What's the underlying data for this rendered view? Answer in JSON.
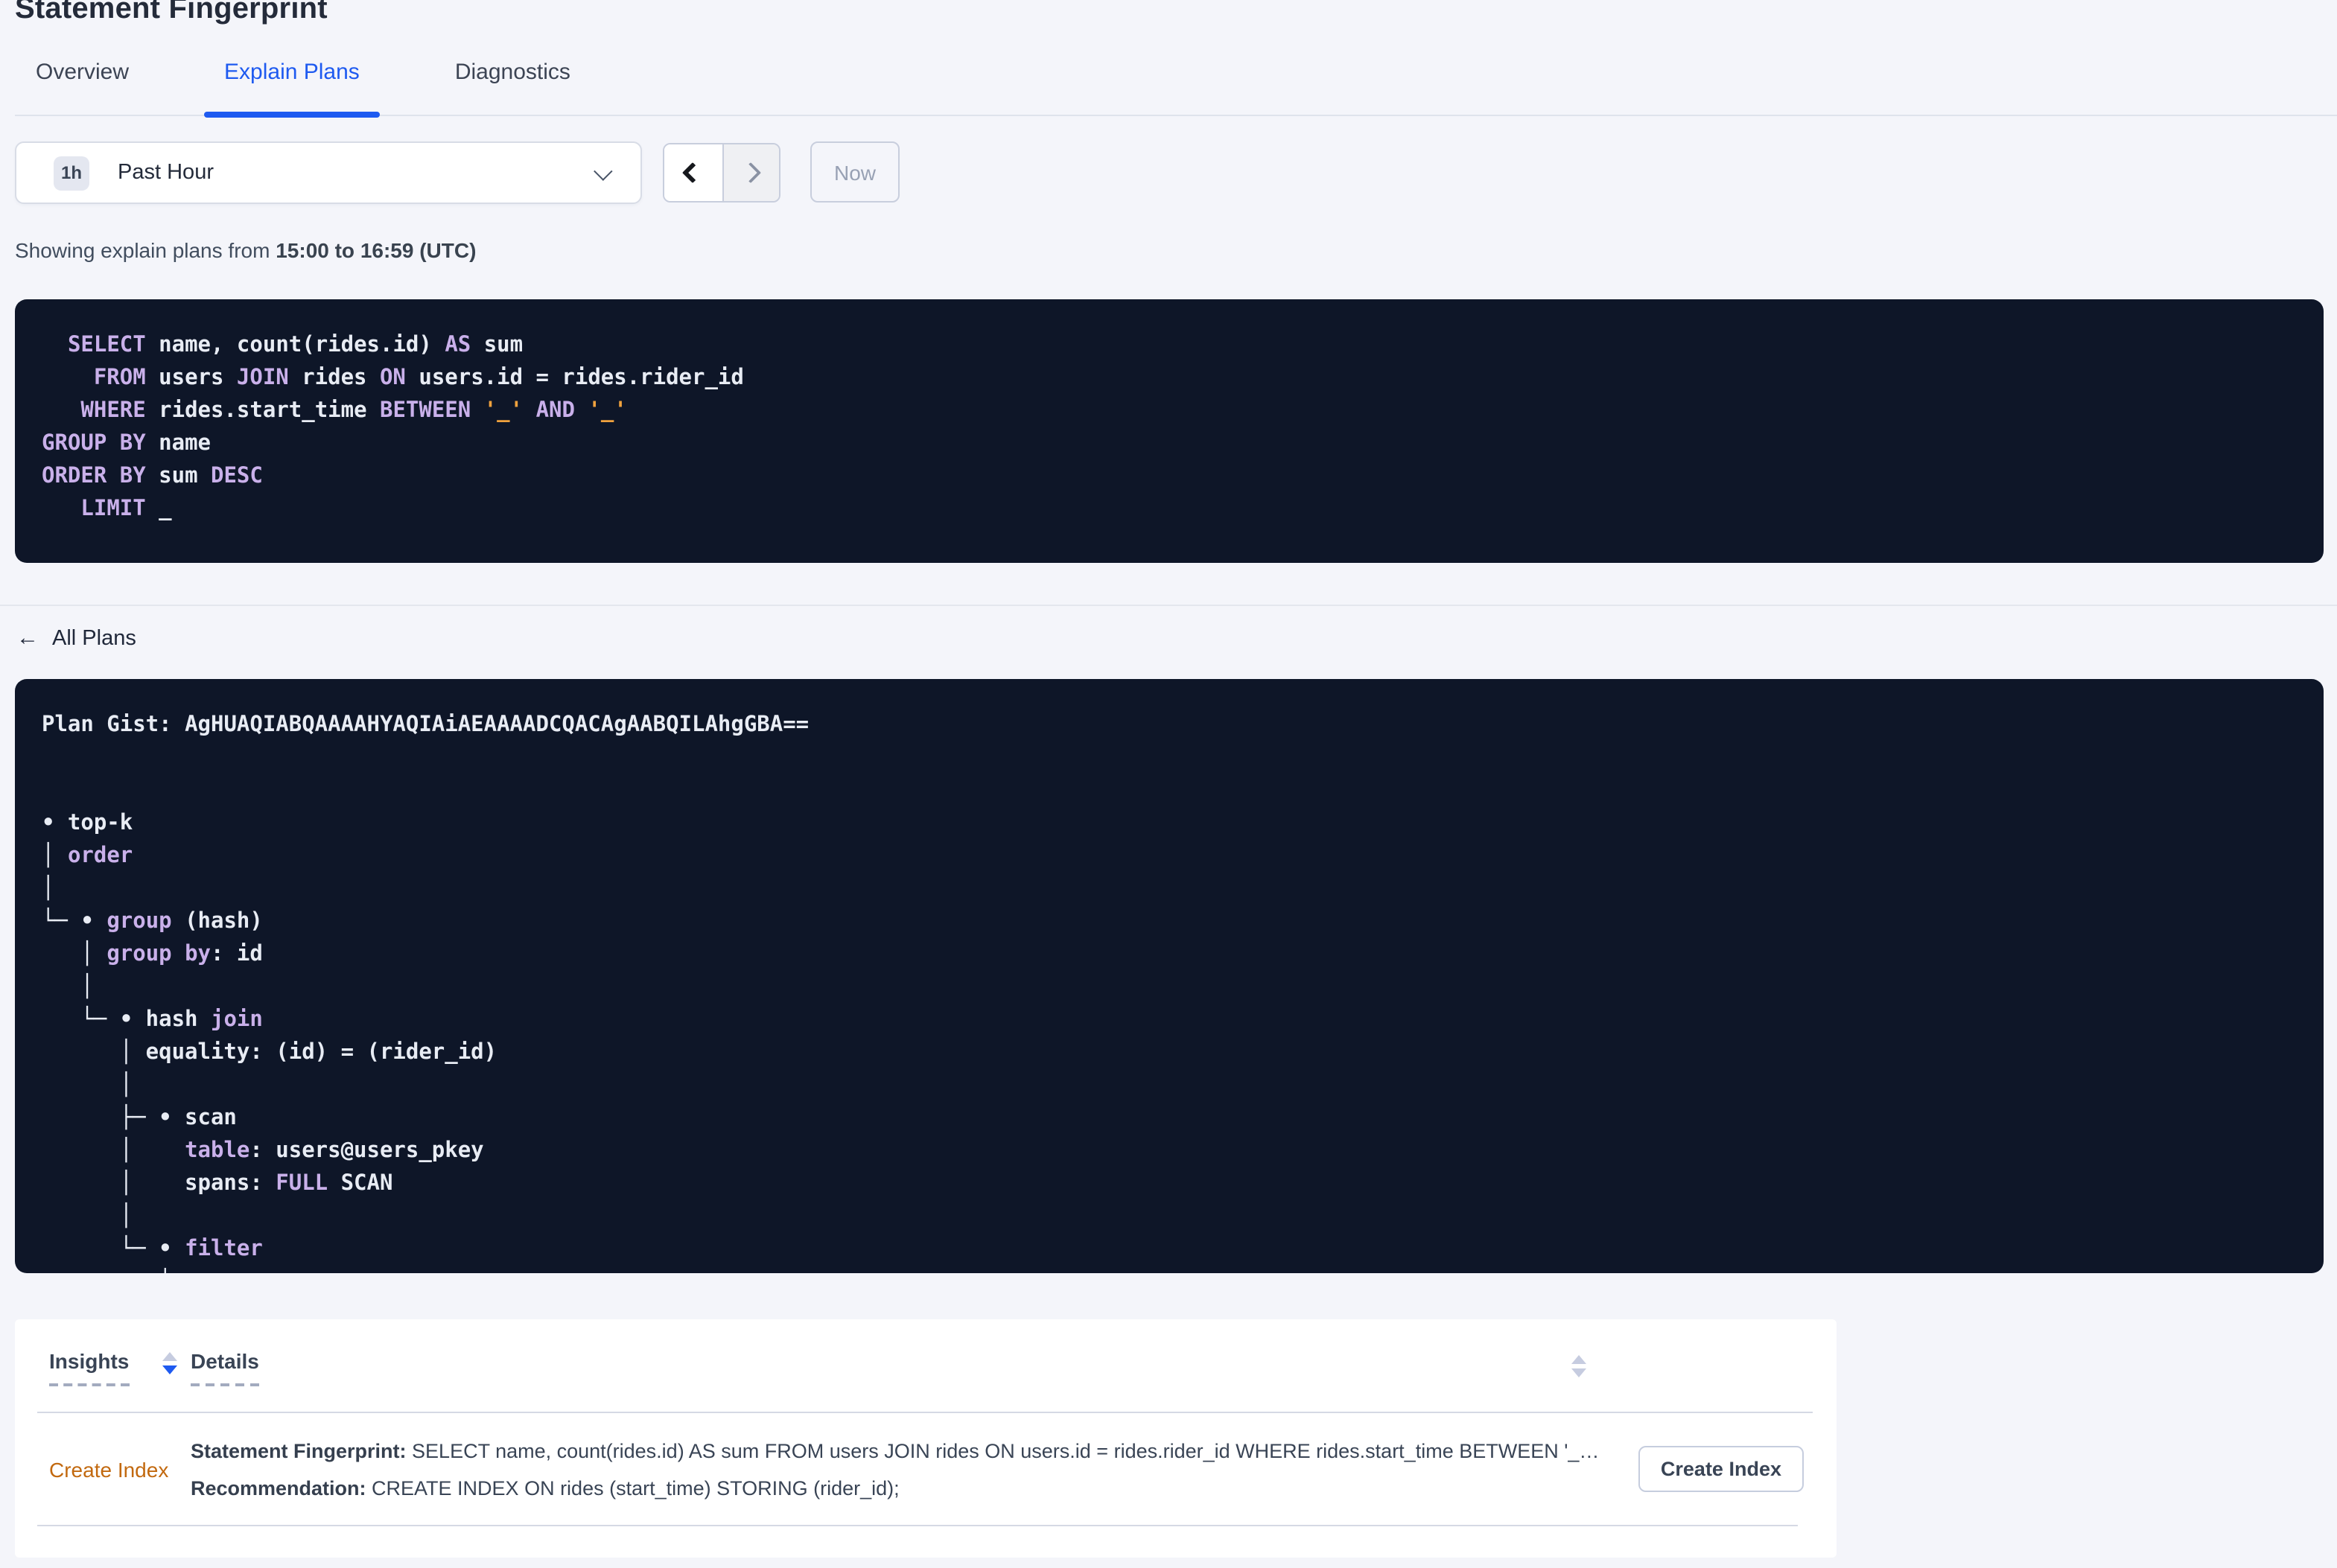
{
  "page": {
    "title": "Statement Fingerprint"
  },
  "tabs": [
    {
      "label": "Overview",
      "active": false
    },
    {
      "label": "Explain Plans",
      "active": true
    },
    {
      "label": "Diagnostics",
      "active": false
    }
  ],
  "time_picker": {
    "badge": "1h",
    "label": "Past Hour",
    "now_label": "Now"
  },
  "showing": {
    "prefix": "Showing explain plans from ",
    "range": "15:00 to 16:59 (UTC)"
  },
  "sql": {
    "lines": [
      [
        [
          "p",
          "  "
        ],
        [
          "k",
          "SELECT"
        ],
        [
          "p",
          " name, count(rides.id) "
        ],
        [
          "k",
          "AS"
        ],
        [
          "p",
          " sum"
        ]
      ],
      [
        [
          "p",
          "    "
        ],
        [
          "k",
          "FROM"
        ],
        [
          "p",
          " users "
        ],
        [
          "k",
          "JOIN"
        ],
        [
          "p",
          " rides "
        ],
        [
          "k",
          "ON"
        ],
        [
          "p",
          " users.id = rides.rider_id"
        ]
      ],
      [
        [
          "p",
          "   "
        ],
        [
          "k",
          "WHERE"
        ],
        [
          "p",
          " rides.start_time "
        ],
        [
          "k",
          "BETWEEN"
        ],
        [
          "p",
          " "
        ],
        [
          "o",
          "'_'"
        ],
        [
          "p",
          " "
        ],
        [
          "k",
          "AND"
        ],
        [
          "p",
          " "
        ],
        [
          "o",
          "'_'"
        ]
      ],
      [
        [
          "k",
          "GROUP BY"
        ],
        [
          "p",
          " name"
        ]
      ],
      [
        [
          "k",
          "ORDER BY"
        ],
        [
          "p",
          " sum "
        ],
        [
          "k",
          "DESC"
        ]
      ],
      [
        [
          "p",
          "   "
        ],
        [
          "k",
          "LIMIT"
        ],
        [
          "p",
          " _"
        ]
      ]
    ]
  },
  "all_plans": {
    "label": "All Plans",
    "arrow": "←"
  },
  "plan": {
    "gist_label": "Plan Gist: ",
    "gist_value": "AgHUAQIABQAAAAHYAQIAiAEAAAADCQACAgAABQILAhgGBA==",
    "tree_lines": [
      [
        [
          "p",
          "• top-k"
        ]
      ],
      [
        [
          "p",
          "│ "
        ],
        [
          "k",
          "order"
        ]
      ],
      [
        [
          "p",
          "│"
        ]
      ],
      [
        [
          "p",
          "└─ • "
        ],
        [
          "k",
          "group"
        ],
        [
          "p",
          " (hash)"
        ]
      ],
      [
        [
          "p",
          "   │ "
        ],
        [
          "k",
          "group by"
        ],
        [
          "p",
          ": id"
        ]
      ],
      [
        [
          "p",
          "   │"
        ]
      ],
      [
        [
          "p",
          "   └─ • hash "
        ],
        [
          "k",
          "join"
        ]
      ],
      [
        [
          "p",
          "      │ equality: (id) = (rider_id)"
        ]
      ],
      [
        [
          "p",
          "      │"
        ]
      ],
      [
        [
          "p",
          "      ├─ • scan"
        ]
      ],
      [
        [
          "p",
          "      │    "
        ],
        [
          "k",
          "table"
        ],
        [
          "p",
          ": users@users_pkey"
        ]
      ],
      [
        [
          "p",
          "      │    spans: "
        ],
        [
          "k",
          "FULL"
        ],
        [
          "p",
          " SCAN"
        ]
      ],
      [
        [
          "p",
          "      │"
        ]
      ],
      [
        [
          "p",
          "      └─ • "
        ],
        [
          "k",
          "filter"
        ]
      ],
      [
        [
          "p",
          "         │"
        ]
      ]
    ]
  },
  "insights_table": {
    "columns": [
      "Insights",
      "Details"
    ],
    "rows": [
      {
        "insight_label": "Create Index",
        "fingerprint_label": "Statement Fingerprint:",
        "fingerprint_text": " SELECT name, count(rides.id) AS sum FROM users JOIN rides ON users.id = rides.rider_id WHERE rides.start_time BETWEEN '_…",
        "recommendation_label": "Recommendation:",
        "recommendation_text": " CREATE INDEX ON rides (start_time) STORING (rider_id);",
        "action_label": "Create Index"
      }
    ]
  },
  "colors": {
    "accent_blue": "#1e5af0",
    "code_background": "#0e1628",
    "code_keyword_purple": "#c9b0ea",
    "code_text": "#e8ecf4",
    "code_literal_orange": "#f0a23e",
    "insight_link_orange": "#c2690f",
    "page_background": "#f4f5fa"
  }
}
